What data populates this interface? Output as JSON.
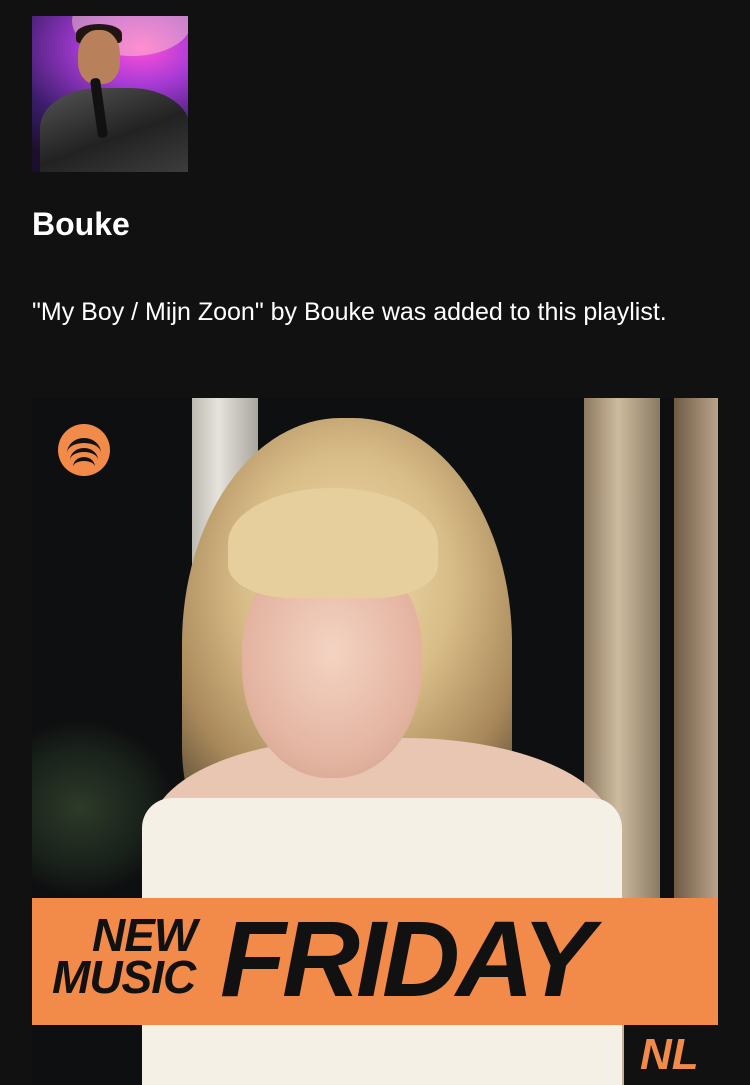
{
  "artist": {
    "name": "Bouke",
    "avatar_icon": "artist-photo"
  },
  "notification": {
    "text": "\"My Boy / Mijn Zoon\" by Bouke was added to this playlist."
  },
  "playlist_cover": {
    "logo_icon": "spotify-icon",
    "accent_color": "#f28a4a",
    "badge_new": "NEW",
    "badge_music": "MUSIC",
    "title": "FRIDAY",
    "region": "NL"
  }
}
